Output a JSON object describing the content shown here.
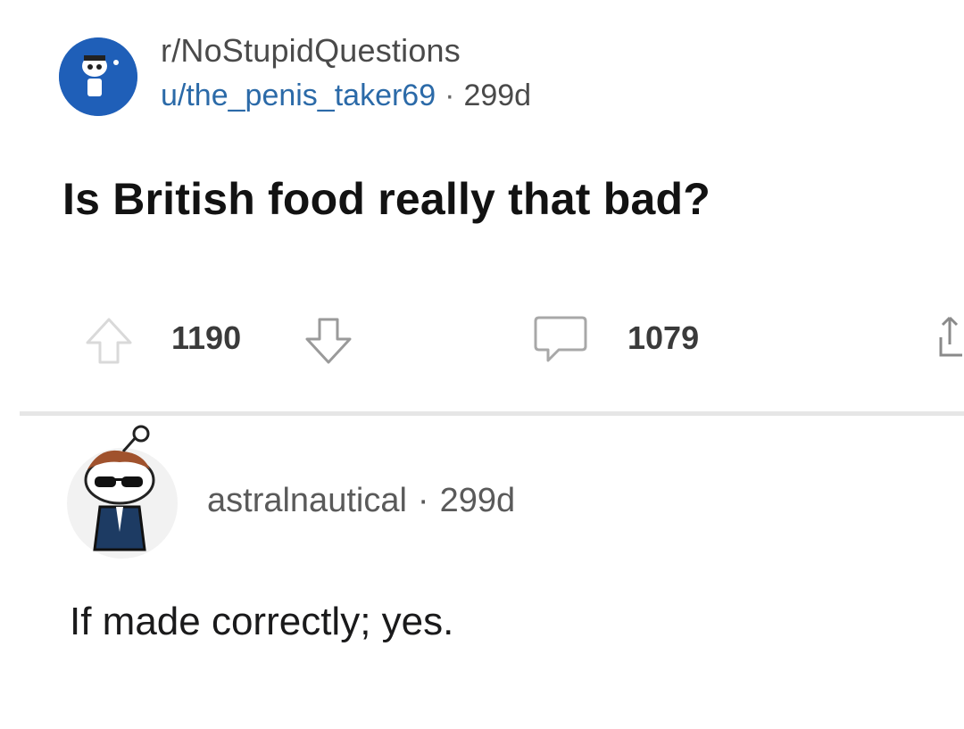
{
  "post": {
    "subreddit": "r/NoStupidQuestions",
    "author": "u/the_penis_taker69",
    "separator": "·",
    "age": "299d",
    "title": "Is British food really that bad?",
    "score": "1190",
    "comment_count": "1079"
  },
  "comment": {
    "author": "astralnautical",
    "separator": "·",
    "age": "299d",
    "body": "If made correctly; yes."
  },
  "colors": {
    "subreddit_avatar_bg": "#1f5fb8",
    "username_link": "#2b6aa8",
    "divider": "#e6e6e6"
  },
  "icons": {
    "upvote": "upvote-arrow-icon",
    "downvote": "downvote-arrow-icon",
    "comment": "comment-bubble-icon",
    "share": "share-icon"
  }
}
